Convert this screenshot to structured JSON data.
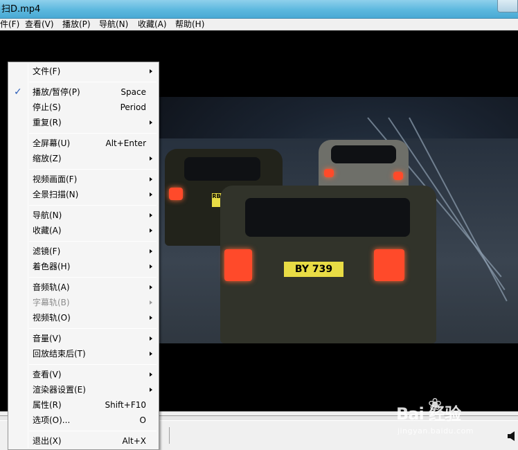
{
  "window": {
    "title": "扫D.mp4"
  },
  "menubar": {
    "items": [
      "件(F)",
      "查看(V)",
      "播放(P)",
      "导航(N)",
      "收藏(A)",
      "帮助(H)"
    ]
  },
  "context_menu": {
    "items": [
      {
        "label": "文件(F)",
        "shortcut": "",
        "submenu": true,
        "checked": false,
        "disabled": false
      },
      {
        "label": "播放/暂停(P)",
        "shortcut": "Space",
        "submenu": false,
        "checked": true,
        "disabled": false
      },
      {
        "label": "停止(S)",
        "shortcut": "Period",
        "submenu": false,
        "checked": false,
        "disabled": false
      },
      {
        "label": "重复(R)",
        "shortcut": "",
        "submenu": true,
        "checked": false,
        "disabled": false
      },
      {
        "label": "全屏幕(U)",
        "shortcut": "Alt+Enter",
        "submenu": false,
        "checked": false,
        "disabled": false
      },
      {
        "label": "缩放(Z)",
        "shortcut": "",
        "submenu": true,
        "checked": false,
        "disabled": false
      },
      {
        "label": "视频画面(F)",
        "shortcut": "",
        "submenu": true,
        "checked": false,
        "disabled": false
      },
      {
        "label": "全景扫描(N)",
        "shortcut": "",
        "submenu": true,
        "checked": false,
        "disabled": false
      },
      {
        "label": "导航(N)",
        "shortcut": "",
        "submenu": true,
        "checked": false,
        "disabled": false
      },
      {
        "label": "收藏(A)",
        "shortcut": "",
        "submenu": true,
        "checked": false,
        "disabled": false
      },
      {
        "label": "滤镜(F)",
        "shortcut": "",
        "submenu": true,
        "checked": false,
        "disabled": false
      },
      {
        "label": "着色器(H)",
        "shortcut": "",
        "submenu": true,
        "checked": false,
        "disabled": false
      },
      {
        "label": "音频轨(A)",
        "shortcut": "",
        "submenu": true,
        "checked": false,
        "disabled": false
      },
      {
        "label": "字幕轨(B)",
        "shortcut": "",
        "submenu": true,
        "checked": false,
        "disabled": true
      },
      {
        "label": "视频轨(O)",
        "shortcut": "",
        "submenu": true,
        "checked": false,
        "disabled": false
      },
      {
        "label": "音量(V)",
        "shortcut": "",
        "submenu": true,
        "checked": false,
        "disabled": false
      },
      {
        "label": "回放结束后(T)",
        "shortcut": "",
        "submenu": true,
        "checked": false,
        "disabled": false
      },
      {
        "label": "查看(V)",
        "shortcut": "",
        "submenu": true,
        "checked": false,
        "disabled": false
      },
      {
        "label": "渲染器设置(E)",
        "shortcut": "",
        "submenu": true,
        "checked": false,
        "disabled": false
      },
      {
        "label": "属性(R)",
        "shortcut": "Shift+F10",
        "submenu": false,
        "checked": false,
        "disabled": false
      },
      {
        "label": "选项(O)...",
        "shortcut": "O",
        "submenu": false,
        "checked": false,
        "disabled": false
      },
      {
        "label": "退出(X)",
        "shortcut": "Alt+X",
        "submenu": false,
        "checked": false,
        "disabled": false
      }
    ]
  },
  "video": {
    "plate_front": "BY 739",
    "plate_left": "RB 6300"
  },
  "watermark": {
    "logo": "Bai 经验",
    "url": "jingyan.baidu.com"
  },
  "colors": {
    "titlebar": "#5cb8de",
    "menu_bg": "#f5f5f5",
    "check": "#2a5db8",
    "disabled_text": "#8d8d8d"
  }
}
